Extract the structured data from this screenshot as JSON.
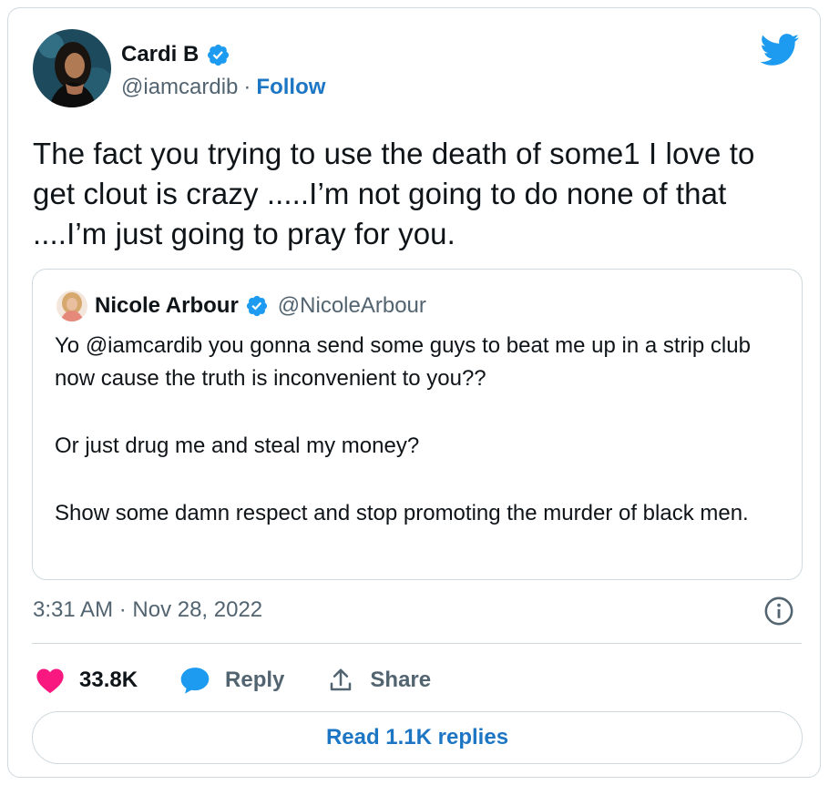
{
  "tweet": {
    "author_name": "Cardi B",
    "author_handle": "@iamcardib",
    "separator": "·",
    "follow_label": "Follow",
    "text": "The fact you trying to use the death of some1 I love to get clout is crazy .....I’m not going to do none of that ....I’m just going to pray for you.",
    "timestamp": "3:31 AM · Nov 28, 2022",
    "likes_count": "33.8K",
    "reply_label": "Reply",
    "share_label": "Share",
    "read_replies_label": "Read 1.1K replies"
  },
  "quoted": {
    "author_name": "Nicole Arbour",
    "author_handle": "@NicoleArbour",
    "paragraphs": [
      "Yo @iamcardib you gonna send some guys to beat me up in a strip club now cause the truth is inconvenient to you??",
      "Or just drug me and steal my money?",
      "Show some damn respect and stop promoting the murder of black men."
    ]
  },
  "colors": {
    "accent": "#1d9bf0",
    "link": "#1d76c4",
    "like": "#f91880",
    "muted": "#536471",
    "border": "#cfd9de"
  },
  "icons": [
    "verified-badge-icon",
    "twitter-bird-icon",
    "info-icon",
    "heart-icon",
    "reply-bubble-icon",
    "share-icon"
  ]
}
